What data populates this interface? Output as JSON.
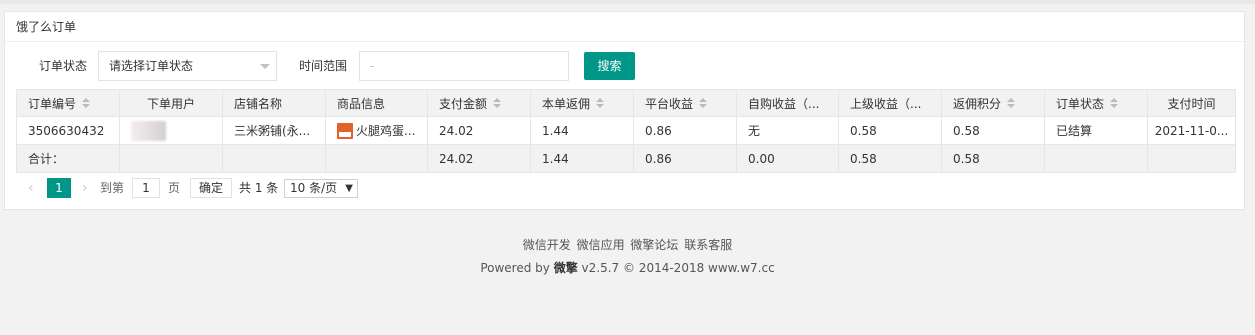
{
  "panel": {
    "title": "饿了么订单"
  },
  "filters": {
    "status_label": "订单状态",
    "status_value": "请选择订单状态",
    "time_label": "时间范围",
    "time_placeholder": "-",
    "search_label": "搜索"
  },
  "table": {
    "columns": [
      "订单编号",
      "下单用户",
      "店铺名称",
      "商品信息",
      "支付金额",
      "本单返佣",
      "平台收益",
      "自购收益（...",
      "上级收益（...",
      "返佣积分",
      "订单状态",
      "支付时间"
    ],
    "row": {
      "order_no": "3506630432",
      "shop": "三米粥铺(永...",
      "goods": "火腿鸡蛋...",
      "pay": "24.02",
      "commission": "1.44",
      "platform": "0.86",
      "self": "无",
      "parent": "0.58",
      "points": "0.58",
      "status": "已结算",
      "time": "2021-11-0..."
    },
    "total": {
      "label": "合计：",
      "pay": "24.02",
      "commission": "1.44",
      "platform": "0.86",
      "self": "0.00",
      "parent": "0.58",
      "points": "0.58"
    }
  },
  "pager": {
    "prev_icon": "‹",
    "current": "1",
    "next_icon": "›",
    "goto_label": "到第",
    "goto_value": "1",
    "page_unit": "页",
    "confirm": "确定",
    "total_text": "共 1 条",
    "size": "10 条/页",
    "size_icon": "▼"
  },
  "footer": {
    "links": [
      "微信开发",
      "微信应用",
      "微擎论坛",
      "联系客服"
    ],
    "powered_prefix": "Powered by",
    "brand": "微擎",
    "version": "v2.5.7 © 2014-2018",
    "site": "www.w7.cc"
  },
  "colors": {
    "accent": "#009688"
  }
}
